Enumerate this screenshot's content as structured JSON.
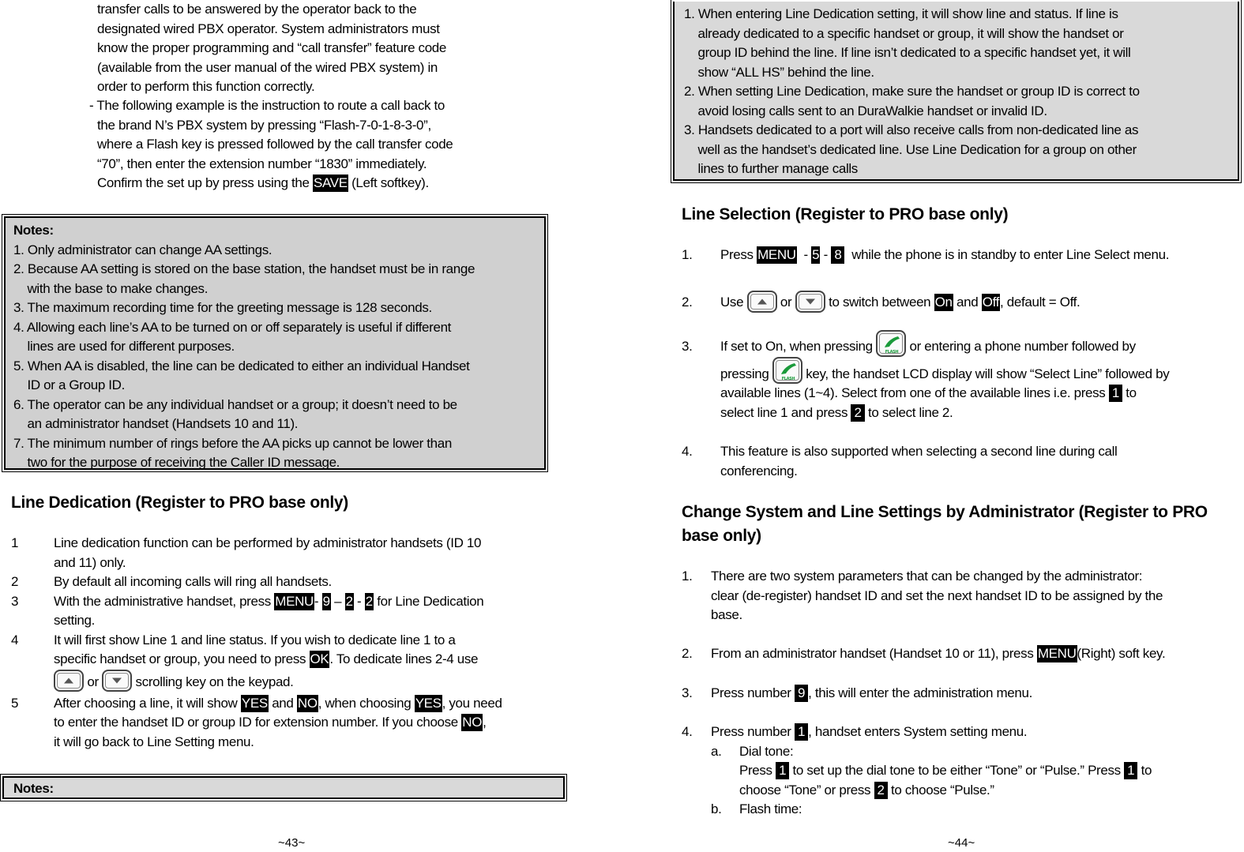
{
  "left_page": {
    "intro_lines": [
      "transfer calls to be answered by the operator back to the",
      "designated wired PBX operator. System administrators must",
      "know the proper programming and “call transfer” feature code",
      "(available from the user manual of the wired PBX system) in",
      "order to perform this function correctly."
    ],
    "example_lines": [
      "- The following example is the instruction to route a call back to",
      "the brand N’s PBX system by pressing “Flash-7-0-1-8-3-0”,",
      "where a Flash key is pressed followed by the call transfer code",
      "“70”, then enter the extension number “1830” immediately."
    ],
    "confirm": {
      "before": "Confirm the set up by press using the ",
      "key": "SAVE",
      "after": " (Left softkey)."
    },
    "notes_box_1": {
      "title": "Notes:",
      "lines": [
        "1. Only administrator can change AA settings.",
        "2. Because AA setting is stored on the base station, the handset must be in range",
        "    with the base to make changes.",
        "3. The maximum recording time for the greeting message is 128 seconds.",
        "4. Allowing each line’s AA to be turned on or off separately is useful if different",
        "    lines are used for different purposes.",
        "5. When AA is disabled, the line can be dedicated to either an individual Handset",
        "    ID or a Group ID.",
        "6. The operator can be any individual handset or a group; it doesn’t need to be",
        "    an administrator handset (Handsets 10 and 11).",
        "7. The minimum number of rings before the AA picks up cannot be lower than",
        "    two for the purpose of receiving the Caller ID message."
      ]
    },
    "line_dedication": {
      "heading": "Line Dedication (Register to PRO base only)",
      "items": [
        {
          "num": "1",
          "lines": [
            "Line dedication function can be performed by administrator handsets (ID 10",
            "and 11) only."
          ]
        },
        {
          "num": "2",
          "lines": [
            "By default all incoming calls will ring all handsets."
          ]
        },
        {
          "num": "3",
          "pre": "With the administrative handset, press ",
          "k1": "MENU",
          "s1": "- ",
          "k2": "9",
          "s2": " – ",
          "k3": "2",
          "s3": " - ",
          "k4": "2",
          "post": " for Line Dedication",
          "line2": "setting."
        },
        {
          "num": "4",
          "line1": "It will first show Line 1 and line status. If you wish to dedicate line 1 to a",
          "pre2": "specific handset or group, you need to press ",
          "key": "OK",
          "post2": ". To dedicate lines 2-4 use",
          "or": " or ",
          "post3": " scrolling key on the keypad."
        },
        {
          "num": "5",
          "p1": "After choosing a line, it will show ",
          "k1": "YES",
          "p2": " and ",
          "k2": "NO",
          "p3": ", when choosing ",
          "k3": "YES",
          "p4": ", you need",
          "p5": "to enter the handset ID or group ID for extension number. If you choose ",
          "k4": "NO",
          "p6": ",",
          "line3": "it will go back to Line Setting menu."
        }
      ]
    },
    "notes_box_2": {
      "title": "Notes:"
    },
    "page_number": "~43~"
  },
  "right_page": {
    "notes_box": {
      "lines": [
        "1. When entering Line Dedication setting, it will show line and status. If line is",
        "    already dedicated to a specific handset or group, it will show the handset or",
        "    group ID behind the line. If line isn’t dedicated to a specific handset yet, it will",
        "    show “ALL HS” behind the line.",
        "2. When setting Line Dedication, make sure the handset or group ID is correct to",
        "    avoid losing calls sent to an DuraWalkie handset or invalid ID.",
        "3. Handsets dedicated to a port will also receive calls from non-dedicated line as",
        "    well as the handset’s dedicated line. Use Line Dedication for a group on other",
        "    lines to further manage calls"
      ]
    },
    "line_selection": {
      "heading": "Line Selection (Register to PRO base only)",
      "item1": {
        "num": "1.",
        "pre": "Press ",
        "k1": "MENU",
        "s1": "  - ",
        "k2": "5",
        "s2": " - ",
        "k3": "8",
        "post": "  while the phone is in standby to enter Line Select menu."
      },
      "item2": {
        "num": "2.",
        "pre": "Use ",
        "or": " or ",
        "mid": " to switch between ",
        "k1": "On",
        "and": " and ",
        "k2": "Off",
        "post": ", default = Off."
      },
      "item3": {
        "num": "3.",
        "pre1": "If set to On, when pressing ",
        "post1": " or entering a phone number followed by",
        "pre2": "pressing ",
        "post2": " key, the handset LCD display will show “Select Line” followed by",
        "pre3": "available lines (1~4).  Select from one of the available lines i.e. press ",
        "k1": "1",
        "post3": " to",
        "pre4": "select line 1 and press ",
        "k2": "2",
        "post4": " to select line 2.",
        "flash_label": "FLASH"
      },
      "item4": {
        "num": "4.",
        "lines": [
          "This feature is also supported when selecting a second line during call",
          "conferencing."
        ]
      }
    },
    "admin_settings": {
      "heading_lines": [
        "Change System and Line Settings by Administrator (Register to PRO",
        "base only)"
      ],
      "item1": {
        "num": "1.",
        "lines": [
          "There are two system parameters that can be changed by the administrator:",
          "clear (de-register) handset ID and set the next handset ID to be assigned by the",
          "base."
        ]
      },
      "item2": {
        "num": "2.",
        "pre": "From an administrator handset (Handset 10 or 11), press ",
        "key": "MENU",
        "post": "(Right) soft key."
      },
      "item3": {
        "num": "3.",
        "pre": "Press number ",
        "key": "9",
        "post": ", this will enter the administration menu."
      },
      "item4": {
        "num": "4.",
        "pre": "Press number ",
        "key": "1",
        "post": ", handset enters System setting menu."
      },
      "sub_a": {
        "label": "a.",
        "title": "Dial tone:",
        "pre": "Press ",
        "k1": "1",
        "mid": " to set up the dial tone to be either “Tone” or “Pulse.” Press ",
        "k2": "1",
        "post": " to",
        "pre2": "choose “Tone” or press ",
        "k3": "2",
        "post2": " to choose “Pulse.”"
      },
      "sub_b": {
        "label": "b.",
        "title": "Flash time:"
      }
    },
    "page_number": "~44~"
  }
}
